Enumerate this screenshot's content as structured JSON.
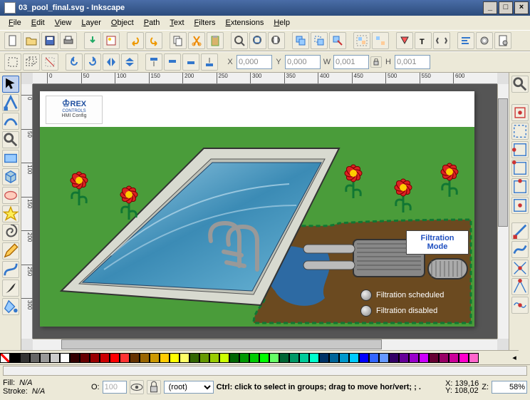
{
  "window": {
    "title": "03_pool_final.svg - Inkscape"
  },
  "menu": [
    "File",
    "Edit",
    "View",
    "Layer",
    "Object",
    "Path",
    "Text",
    "Filters",
    "Extensions",
    "Help"
  ],
  "coords": {
    "X_label": "X",
    "X": "0,000",
    "Y_label": "Y",
    "Y": "0,000",
    "W_label": "W",
    "W": "0,001",
    "H_label": "H",
    "H": "0,001"
  },
  "ruler_h": [
    0,
    50,
    100,
    150,
    200,
    250,
    300,
    350,
    400,
    450,
    500,
    550,
    600
  ],
  "ruler_v": [
    0,
    50,
    100,
    150,
    200,
    250,
    300
  ],
  "logo": {
    "brand": "REX",
    "sub": "HMI Config",
    "controls": "CONTROLS"
  },
  "panel": {
    "mode": "Filtration Mode",
    "sched": "Filtration scheduled",
    "dis": "Filtration disabled"
  },
  "status": {
    "fill": "Fill:",
    "stroke": "Stroke:",
    "na": "N/A",
    "o_label": "O:",
    "o": "100",
    "layer": "(root)",
    "hint": "Ctrl: click to select in groups; drag to move hor/vert; ; .",
    "xl": "X:",
    "x": "139,16",
    "yl": "Y:",
    "y": "108,02",
    "zl": "Z:",
    "z": "58%"
  },
  "palette": [
    "#000000",
    "#333333",
    "#666666",
    "#999999",
    "#cccccc",
    "#ffffff",
    "#330000",
    "#660000",
    "#990000",
    "#cc0000",
    "#ff0000",
    "#ff3333",
    "#663300",
    "#996600",
    "#cc9900",
    "#ffcc00",
    "#ffff00",
    "#ffff66",
    "#336600",
    "#669900",
    "#99cc00",
    "#ccff00",
    "#006600",
    "#009900",
    "#00cc00",
    "#00ff00",
    "#66ff66",
    "#006633",
    "#009966",
    "#00cc99",
    "#00ffcc",
    "#003366",
    "#006699",
    "#0099cc",
    "#00ccff",
    "#0000ff",
    "#3366ff",
    "#6699ff",
    "#330066",
    "#660099",
    "#9900cc",
    "#cc00ff",
    "#660033",
    "#990066",
    "#cc0099",
    "#ff00cc",
    "#ff66cc"
  ]
}
